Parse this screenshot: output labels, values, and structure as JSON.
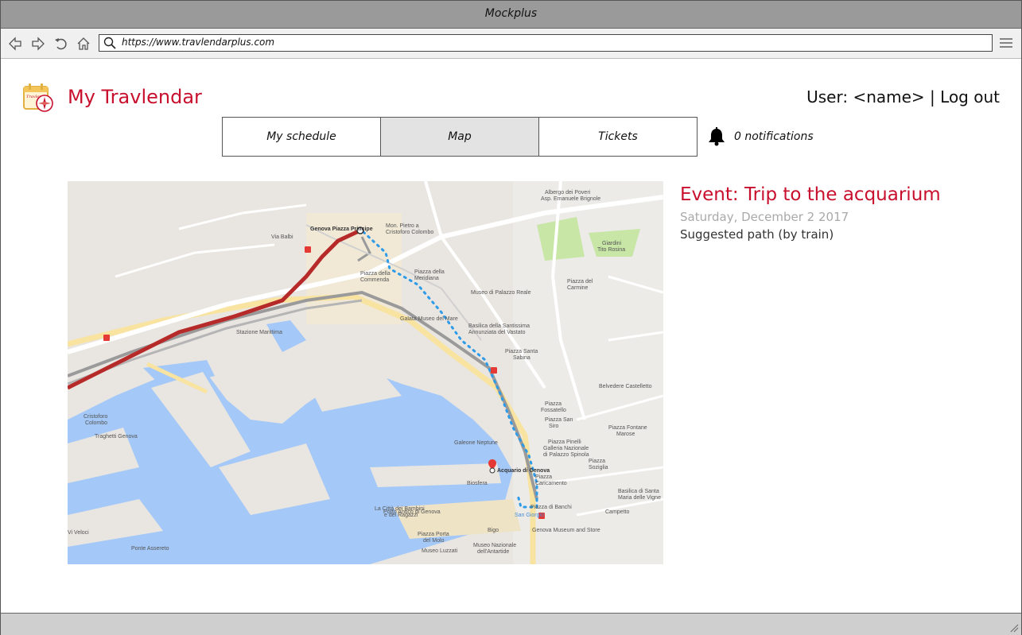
{
  "window": {
    "title": "Mockplus"
  },
  "browser": {
    "url": "https://www.travlendarplus.com"
  },
  "app": {
    "title": "My Travlendar",
    "logo_text": "Travlendar"
  },
  "user_bar": {
    "user_text": "User: <name>",
    "separator": "|",
    "logout_label": "Log out"
  },
  "tabs": [
    {
      "label": "My schedule",
      "active": false
    },
    {
      "label": "Map",
      "active": true
    },
    {
      "label": "Tickets",
      "active": false
    }
  ],
  "notifications": {
    "text": "0 notifications"
  },
  "event": {
    "title": "Event: Trip to the acquarium",
    "date": "Saturday, December 2 2017",
    "path_note": "Suggested path (by train)"
  },
  "map": {
    "labels": {
      "start_station": "Genova Piazza Principe",
      "destination": "Acquario di Genova",
      "columbus": "Mon. Pietro a",
      "columbus2": "Cristoforo Colombo",
      "commenda": "Piazza della",
      "commenda2": "Commenda",
      "marittima": "Stazione Marittima",
      "galata": "Galata Museo del Mare",
      "meridiana": "Piazza della",
      "meridiana2": "Meridiana",
      "palazzo_reale": "Museo di Palazzo Reale",
      "annunziata": "Basilica della Santissima",
      "annunziata2": "Annunziata del Vastato",
      "sabina": "Piazza Santa",
      "sabina2": "Sabina",
      "fossatello": "Piazza",
      "fossatello2": "Fossatello",
      "siro": "Piazza San",
      "siro2": "Siro",
      "bianchi": "Piazza di Banchi",
      "caricamento": "Piazza",
      "caricamento2": "Caricamento",
      "neptune": "Galeone Neptune",
      "bigo": "Bigo",
      "biosfera": "Biosfera",
      "porto_antico": "Porto Antico di Genova",
      "bambini": "La Città dei Bambini",
      "bambini2": "e dei Ragazzi",
      "molo": "Piazza Porta",
      "molo2": "del Molo",
      "luzzati": "Museo Luzzati",
      "antartide": "Museo Nazionale",
      "antartide2": "dell'Antartide",
      "genova_museum": "Genova Museum and Store",
      "traghetti": "Traghetti Genova",
      "colombo": "Cristoforo",
      "colombo2": "Colombo",
      "assereto": "Ponte Assereto",
      "veloci": "Vi Veloci",
      "carmine": "Piazza del",
      "carmine2": "Carmine",
      "castelletto": "Belvedere Castelletto",
      "pinelli": "Piazza Pinelli",
      "spinola": "Galleria Nazionale",
      "spinola2": "di Palazzo Spinola",
      "soziglia": "Piazza",
      "soziglia2": "Soziglia",
      "campetto": "Campetto",
      "vigne": "Basilica di Santa",
      "vigne2": "Maria delle Vigne",
      "doria": "Albergo dei Poveri",
      "doria2": "Asp. Emanuele Brignole",
      "giardini": "Giardini",
      "giardini2": "Tito Rosina",
      "annunziata_station": "San Giorgio",
      "fontane": "Piazza Fontane",
      "fontane2": "Marose",
      "benettin": "Via Balbi"
    }
  }
}
